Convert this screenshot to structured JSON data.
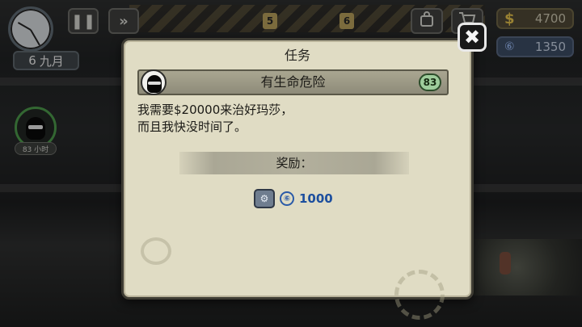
{
  "hud": {
    "date_day": "6",
    "date_month": "九月",
    "pause_icon": "pause-icon",
    "fast_forward_icon": "fast-forward-icon",
    "room_numbers": [
      "5",
      "6"
    ],
    "money": {
      "icon": "dollar-icon",
      "symbol": "$",
      "value": "4700"
    },
    "parts": {
      "icon": "parts-coin-icon",
      "symbol": "⑥",
      "value": "1350"
    }
  },
  "character": {
    "level_tag": "83 小时"
  },
  "dialog": {
    "title": "任务",
    "close_label": "✖",
    "mission": {
      "name": "有生命危险",
      "level": "83"
    },
    "description_lines": [
      "我需要$20000来治好玛莎，",
      "而且我快没时间了。"
    ],
    "reward_label": "奖励：",
    "reward": {
      "coin_symbol": "⑥",
      "value": "1000"
    }
  },
  "colors": {
    "dialog_bg": "#e0dcc4",
    "reward_blue": "#1d4f9e",
    "level_green": "#9fcd9c"
  }
}
